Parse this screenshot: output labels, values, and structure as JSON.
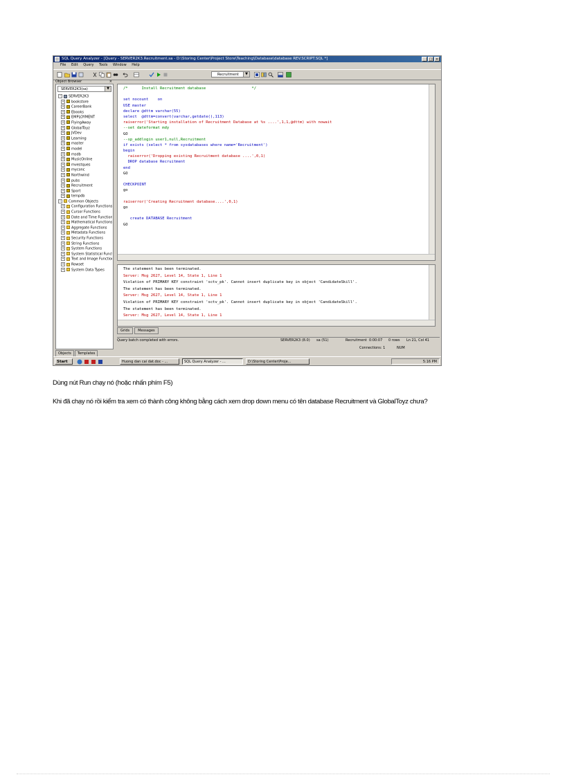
{
  "screenshot": {
    "window_title": "SQL Query Analyzer - [Query - SERVER2K3.Recruitment.sa - D:\\Storing Center\\Project Store\\Teaching\\Database\\database REV.SCRIPT.SQL *]",
    "menu": [
      "File",
      "Edit",
      "Query",
      "Tools",
      "Window",
      "Help"
    ],
    "database_dropdown": "Recruitment",
    "object_browser": {
      "header": "Object Browser",
      "server_select": "SERVER2K3(sa)",
      "tree": [
        {
          "label": "SERVER2K3",
          "type": "server"
        },
        {
          "label": "bookstore",
          "type": "db"
        },
        {
          "label": "CareerBank",
          "type": "db"
        },
        {
          "label": "Ebooks",
          "type": "db"
        },
        {
          "label": "EMPLOYMENT",
          "type": "db"
        },
        {
          "label": "FlyingAway",
          "type": "db"
        },
        {
          "label": "GlobalToyz",
          "type": "db"
        },
        {
          "label": "JVDev",
          "type": "db"
        },
        {
          "label": "Learning",
          "type": "db"
        },
        {
          "label": "master",
          "type": "db"
        },
        {
          "label": "model",
          "type": "db"
        },
        {
          "label": "msdb",
          "type": "db"
        },
        {
          "label": "MusicOnline",
          "type": "db"
        },
        {
          "label": "mvestques",
          "type": "db"
        },
        {
          "label": "myconc",
          "type": "db"
        },
        {
          "label": "Northwind",
          "type": "db"
        },
        {
          "label": "pubs",
          "type": "db"
        },
        {
          "label": "Recruitment",
          "type": "db"
        },
        {
          "label": "Sport",
          "type": "db"
        },
        {
          "label": "tempdb",
          "type": "db"
        },
        {
          "label": "Common Objects",
          "type": "folder"
        },
        {
          "label": "Configuration Functions",
          "type": "folder"
        },
        {
          "label": "Cursor Functions",
          "type": "folder"
        },
        {
          "label": "Date and Time Functions",
          "type": "folder"
        },
        {
          "label": "Mathematical Functions",
          "type": "folder"
        },
        {
          "label": "Aggregate Functions",
          "type": "folder"
        },
        {
          "label": "Metadata Functions",
          "type": "folder"
        },
        {
          "label": "Security Functions",
          "type": "folder"
        },
        {
          "label": "String Functions",
          "type": "folder"
        },
        {
          "label": "System Functions",
          "type": "folder"
        },
        {
          "label": "System Statistical Functions",
          "type": "folder"
        },
        {
          "label": "Text and Image Functions",
          "type": "folder"
        },
        {
          "label": "Rowset",
          "type": "folder"
        },
        {
          "label": "System Data Types",
          "type": "folder"
        }
      ],
      "tabs": [
        "Objects",
        "Templates"
      ]
    },
    "code_lines": [
      {
        "t": "/*      Install Recruitment database                    */",
        "c": "cm"
      },
      {
        "t": "",
        "c": ""
      },
      {
        "t": "set nocount    on",
        "c": "kw"
      },
      {
        "t": "USE master",
        "c": "kw"
      },
      {
        "t": "declare @dttm varchar(55)",
        "c": "kw"
      },
      {
        "t": "select  @dttm=convert(varchar,getdate(),113)",
        "c": "kw"
      },
      {
        "t": "raiserror('Starting installation of Recruitment Database at %s ....',1,1,@dttm) with nowait",
        "c": "str"
      },
      {
        "t": "--set dateformat mdy",
        "c": "cm"
      },
      {
        "t": "GO",
        "c": ""
      },
      {
        "t": "--sp_addlogin user1,null,Recruitment",
        "c": "cm"
      },
      {
        "t": "if exists (select * from sysdatabases where name='Recruitment')",
        "c": "kw"
      },
      {
        "t": "begin",
        "c": "kw"
      },
      {
        "t": "  raiserror('Dropping existing Recruitment database ....',0,1)",
        "c": "str"
      },
      {
        "t": "  DROP database Recruitment",
        "c": "kw"
      },
      {
        "t": "end",
        "c": "kw"
      },
      {
        "t": "GO",
        "c": ""
      },
      {
        "t": "",
        "c": ""
      },
      {
        "t": "CHECKPOINT",
        "c": "kw"
      },
      {
        "t": "go",
        "c": ""
      },
      {
        "t": "",
        "c": ""
      },
      {
        "t": "raiserror('Creating Recruitment database....',0,1)",
        "c": "str"
      },
      {
        "t": "go",
        "c": ""
      },
      {
        "t": "",
        "c": ""
      },
      {
        "t": "   create DATABASE Recruitment",
        "c": "kw"
      },
      {
        "t": "GO",
        "c": ""
      }
    ],
    "result_lines": [
      {
        "t": "The statement has been terminated.",
        "c": ""
      },
      {
        "t": "Server: Msg 2627, Level 14, State 1, Line 1",
        "c": "str"
      },
      {
        "t": "Violation of PRIMARY KEY constraint 'sctv_pk'. Cannot insert duplicate key in object 'CandidateSkill'.",
        "c": ""
      },
      {
        "t": "The statement has been terminated.",
        "c": ""
      },
      {
        "t": "Server: Msg 2627, Level 14, State 1, Line 1",
        "c": "str"
      },
      {
        "t": "Violation of PRIMARY KEY constraint 'sctv_pk'. Cannot insert duplicate key in object 'CandidateSkill'.",
        "c": ""
      },
      {
        "t": "The statement has been terminated.",
        "c": ""
      },
      {
        "t": "Server: Msg 2627, Level 14, State 1, Line 1",
        "c": "str"
      }
    ],
    "result_tabs": [
      "Grids",
      "Messages"
    ],
    "status": {
      "message": "Query batch completed with errors.",
      "server": "SERVER2K3 (8.0)",
      "user": "sa (51)",
      "database": "Recruitment",
      "time": "0:00:07",
      "rows": "0 rows",
      "position": "Ln 21, Col 41",
      "connections": "Connections: 1",
      "num": "NUM"
    },
    "taskbar": {
      "start": "Start",
      "tasks": [
        "Huong dan cai dat.doc - ...",
        "SQL Query Analyzer - ...",
        "D:\\Storing Center\\Proje..."
      ],
      "clock": "5:16 PM"
    }
  },
  "caption1": "Dùng nút Run chạy nó (hoặc nhấn phím F5)",
  "caption2": "Khi đã chạy nó rồi kiểm tra xem có thành công không bằng cách xem drop down menu có tên database Recruitment và GlobalToyz chưa?"
}
